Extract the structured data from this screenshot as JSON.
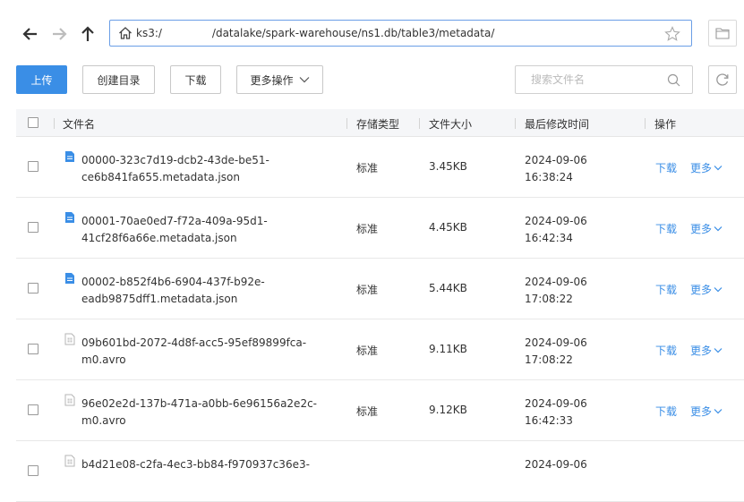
{
  "toolbar_nav": {
    "back_icon": "arrow-left-icon",
    "forward_icon": "arrow-right-icon",
    "up_icon": "arrow-up-icon"
  },
  "address_bar": {
    "host_prefix": "ks3:/",
    "path": "/datalake/spark-warehouse/ns1.db/table3/metadata/",
    "home_icon": "home-icon",
    "favorite_icon": "star-icon"
  },
  "actions": {
    "upload": "上传",
    "create_dir": "创建目录",
    "download": "下载",
    "more_ops": "更多操作"
  },
  "search": {
    "placeholder": "搜索文件名"
  },
  "table": {
    "headers": {
      "name": "文件名",
      "storage_type": "存储类型",
      "size": "文件大小",
      "modified": "最后修改时间",
      "ops": "操作"
    },
    "row_actions": {
      "download": "下载",
      "more": "更多"
    },
    "rows": [
      {
        "icon": "json-file-icon",
        "name_line1": "00000-323c7d19-dcb2-43de-be51-",
        "name_line2": "ce6b841fa655.metadata.json",
        "storage_type": "标准",
        "size": "3.45KB",
        "date": "2024-09-06",
        "time": "16:38:24"
      },
      {
        "icon": "json-file-icon",
        "name_line1": "00001-70ae0ed7-f72a-409a-95d1-",
        "name_line2": "41cf28f6a66e.metadata.json",
        "storage_type": "标准",
        "size": "4.45KB",
        "date": "2024-09-06",
        "time": "16:42:34"
      },
      {
        "icon": "json-file-icon",
        "name_line1": "00002-b852f4b6-6904-437f-b92e-",
        "name_line2": "eadb9875dff1.metadata.json",
        "storage_type": "标准",
        "size": "5.44KB",
        "date": "2024-09-06",
        "time": "17:08:22"
      },
      {
        "icon": "binary-file-icon",
        "name_line1": "09b601bd-2072-4d8f-acc5-95ef89899fca-",
        "name_line2": "m0.avro",
        "storage_type": "标准",
        "size": "9.11KB",
        "date": "2024-09-06",
        "time": "17:08:22"
      },
      {
        "icon": "binary-file-icon",
        "name_line1": "96e02e2d-137b-471a-a0bb-6e96156a2e2c-",
        "name_line2": "m0.avro",
        "storage_type": "标准",
        "size": "9.12KB",
        "date": "2024-09-06",
        "time": "16:42:33"
      },
      {
        "icon": "binary-file-icon",
        "name_line1": "b4d21e08-c2fa-4ec3-bb84-f970937c36e3-",
        "name_line2": "",
        "storage_type": "",
        "size": "",
        "date": "2024-09-06",
        "time": ""
      }
    ]
  },
  "colors": {
    "accent": "#3a8ee6",
    "header_bg": "#f5f6f8",
    "border": "#e8e8e8"
  }
}
